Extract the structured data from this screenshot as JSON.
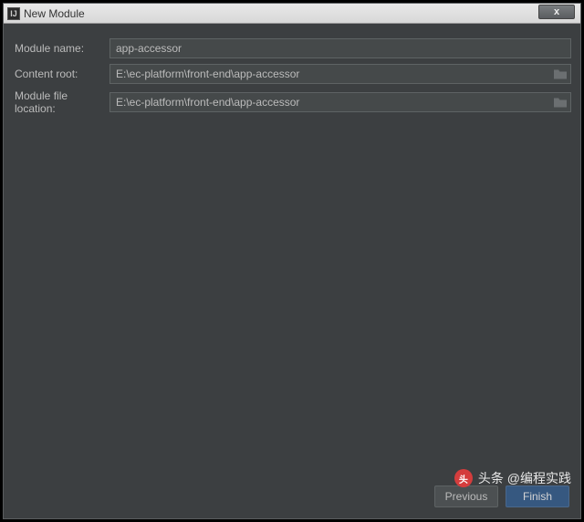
{
  "window": {
    "title": "New Module",
    "close": "x"
  },
  "form": {
    "moduleName": {
      "label": "Module name:",
      "value": "app-accessor"
    },
    "contentRoot": {
      "label": "Content root:",
      "value": "E:\\ec-platform\\front-end\\app-accessor"
    },
    "moduleFileLocation": {
      "label": "Module file location:",
      "value": "E:\\ec-platform\\front-end\\app-accessor"
    }
  },
  "buttons": {
    "previous": "Previous",
    "finish": "Finish"
  },
  "watermark": {
    "logo": "头",
    "text": "头条 @编程实践"
  }
}
